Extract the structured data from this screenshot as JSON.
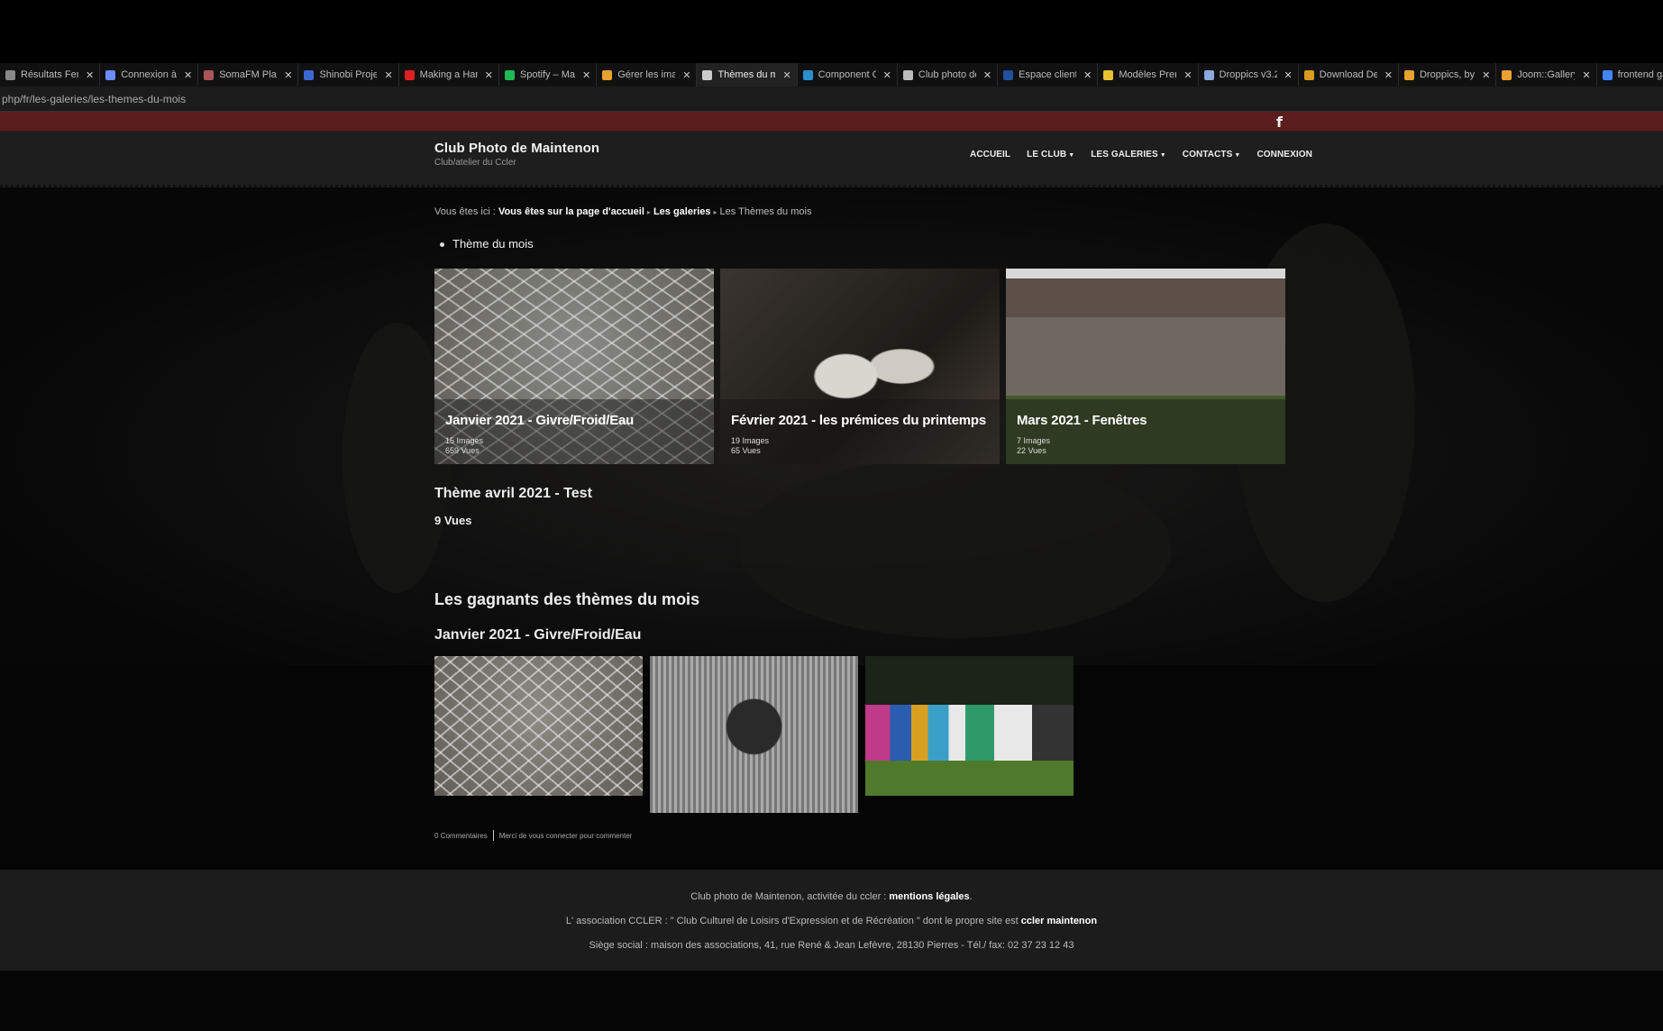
{
  "browser": {
    "tabs": [
      {
        "label": "Résultats Fenê",
        "color": "#888"
      },
      {
        "label": "Connexion à",
        "color": "#6a8cff"
      },
      {
        "label": "SomaFM Playe",
        "color": "#a55"
      },
      {
        "label": "Shinobi Proje",
        "color": "#3a6ad0"
      },
      {
        "label": "Making a Han",
        "color": "#e02020"
      },
      {
        "label": "Spotify – Ma",
        "color": "#1db954"
      },
      {
        "label": "Gérer les imag",
        "color": "#e8a030"
      },
      {
        "label": "Thèmes du m",
        "color": "#ccc"
      },
      {
        "label": "Component C",
        "color": "#2a8fd0"
      },
      {
        "label": "Club photo de",
        "color": "#bbb"
      },
      {
        "label": "Espace client",
        "color": "#2050a0"
      },
      {
        "label": "Modèles Prem",
        "color": "#e8c030"
      },
      {
        "label": "Droppics v3.2",
        "color": "#88aadd"
      },
      {
        "label": "Download De",
        "color": "#d89a20"
      },
      {
        "label": "Droppics, by",
        "color": "#e8a030"
      },
      {
        "label": "Joom::Gallery",
        "color": "#e8a030"
      },
      {
        "label": "frontend galle",
        "color": "#4285f4"
      }
    ],
    "url": "php/fr/les-galeries/les-themes-du-mois"
  },
  "header": {
    "title": "Club Photo de Maintenon",
    "subtitle": "Club/atelier du Ccler",
    "nav": [
      {
        "label": "ACCUEIL",
        "dropdown": false
      },
      {
        "label": "LE CLUB",
        "dropdown": true
      },
      {
        "label": "LES GALERIES",
        "dropdown": true
      },
      {
        "label": "CONTACTS",
        "dropdown": true
      },
      {
        "label": "CONNEXION",
        "dropdown": false
      }
    ],
    "facebook_glyph": "f"
  },
  "breadcrumb": {
    "prefix": "Vous êtes ici :",
    "home": "Vous êtes sur la page d'accueil",
    "galleries": "Les galeries",
    "current": "Les Thèmes du mois"
  },
  "category_item": "Thème du mois",
  "cards": [
    {
      "title": "Janvier 2021 - Givre/Froid/Eau",
      "images": "15 Images",
      "views": "659 Vues"
    },
    {
      "title": "Février 2021 - les prémices du printemps",
      "images": "19 Images",
      "views": "65 Vues"
    },
    {
      "title": "Mars 2021 - Fenêtres",
      "images": "7 Images",
      "views": "22 Vues"
    }
  ],
  "theme": {
    "title": "Thème avril 2021 - Test",
    "views": "9 Vues"
  },
  "winners": {
    "title": "Les gagnants des thèmes du mois",
    "subtitle": "Janvier 2021 - Givre/Froid/Eau"
  },
  "comments": {
    "count": "0 Commentaires",
    "login": "Merci de vous connecter pour commenter"
  },
  "footer": {
    "line1_prefix": "Club photo de Maintenon, activitée du ccler :",
    "line1_link": "mentions légales",
    "line1_suffix": ".",
    "line2_prefix": "L' association CCLER : \" Club Culturel de Loisirs d'Expression et de Récréation \" dont le propre site est",
    "line2_link": "ccler maintenon",
    "line3": "Siège social : maison des associations, 41, rue René & Jean Lefèvre, 28130 Pierres - Tél./ fax: 02 37 23 12 43"
  }
}
